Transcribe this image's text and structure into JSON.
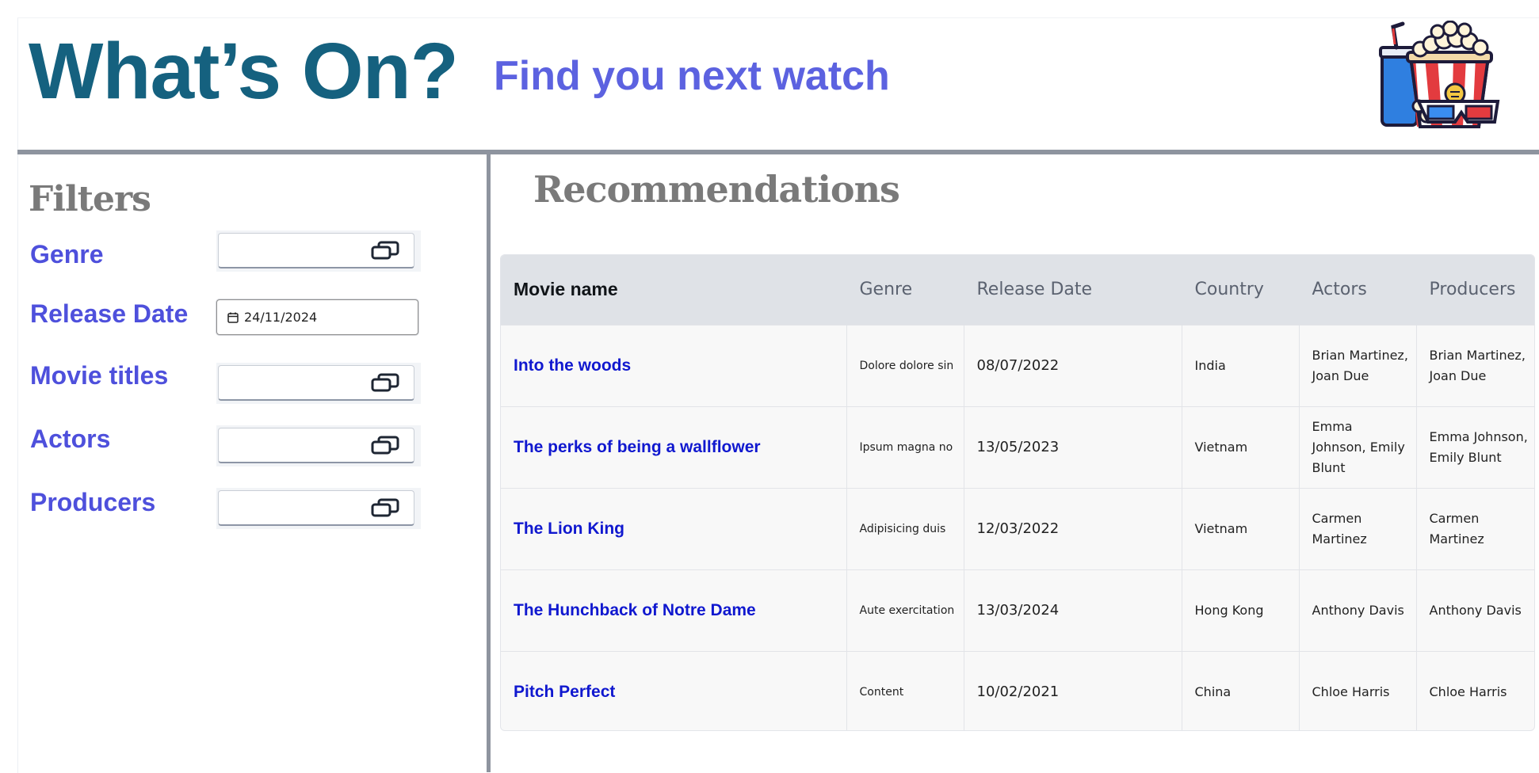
{
  "header": {
    "title": "What’s On?",
    "subtitle": "Find you next watch",
    "logo_icon": "popcorn-3d-glasses-icon"
  },
  "filters": {
    "heading": "Filters",
    "genre_label": "Genre",
    "release_date_label": "Release Date",
    "release_date_value": "24/11/2024",
    "movie_titles_label": "Movie titles",
    "actors_label": "Actors",
    "producers_label": "Producers",
    "field_icon": "window-restore-icon"
  },
  "recommendations": {
    "heading": "Recommendations",
    "columns": [
      "Movie name",
      "Genre",
      "Release Date",
      "Country",
      "Actors",
      "Producers"
    ],
    "rows": [
      {
        "name": "Into the woods",
        "genre": "Dolore dolore sin",
        "date": "08/07/2022",
        "country": "India",
        "actors": "Brian Martinez, Joan Due",
        "producers": "Brian Martinez, Joan Due"
      },
      {
        "name": "The perks of being a wallflower",
        "genre": "Ipsum magna no",
        "date": "13/05/2023",
        "country": "Vietnam",
        "actors": "Emma Johnson, Emily Blunt",
        "producers": "Emma Johnson, Emily Blunt"
      },
      {
        "name": "The Lion King",
        "genre": "Adipisicing duis",
        "date": "12/03/2022",
        "country": "Vietnam",
        "actors": "Carmen Martinez",
        "producers": "Carmen Martinez"
      },
      {
        "name": "The Hunchback of Notre Dame",
        "genre": "Aute exercitation",
        "date": "13/03/2024",
        "country": "Hong Kong",
        "actors": "Anthony Davis",
        "producers": "Anthony Davis"
      },
      {
        "name": "Pitch Perfect",
        "genre": "Content",
        "date": "10/02/2021",
        "country": "China",
        "actors": "Chloe Harris",
        "producers": "Chloe Harris"
      }
    ]
  },
  "colors": {
    "title": "#15617f",
    "subtitle": "#5c62e0",
    "filter_label": "#4e50dc",
    "heading_gray": "#7a7a7a",
    "link_blue": "#1018cf",
    "divider": "#8e949f"
  }
}
